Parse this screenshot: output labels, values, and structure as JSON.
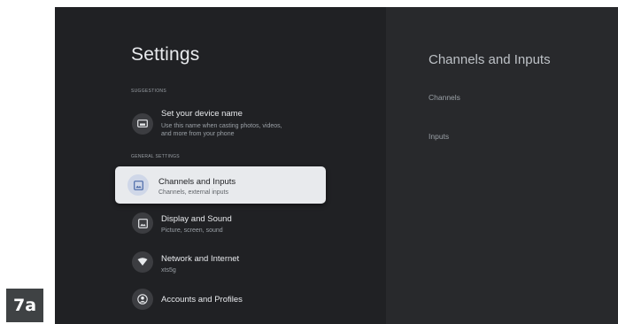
{
  "figure_label": "7a",
  "settings": {
    "title": "Settings",
    "sections": {
      "suggestions": "SUGGESTIONS",
      "general": "GENERAL SETTINGS"
    },
    "items": [
      {
        "icon": "cast-screen-icon",
        "title": "Set your device name",
        "subtitle_lines": [
          "Use this name when casting photos, videos,",
          "and more from your phone"
        ]
      },
      {
        "icon": "image-input-icon",
        "title": "Channels and Inputs",
        "subtitle": "Channels, external inputs",
        "selected": true
      },
      {
        "icon": "display-icon",
        "title": "Display and Sound",
        "subtitle": "Picture, screen, sound"
      },
      {
        "icon": "wifi-icon",
        "title": "Network and Internet",
        "subtitle": "xts5g"
      },
      {
        "icon": "account-icon",
        "title": "Accounts and Profiles"
      }
    ]
  },
  "detail_panel": {
    "title": "Channels and Inputs",
    "items": [
      "Channels",
      "Inputs"
    ]
  },
  "colors": {
    "background": "#202124",
    "panel": "#28292c",
    "selected_card": "#e8eaed",
    "selected_icon_bg": "#cfd7e8",
    "accent_icon": "#4a6aa8"
  }
}
